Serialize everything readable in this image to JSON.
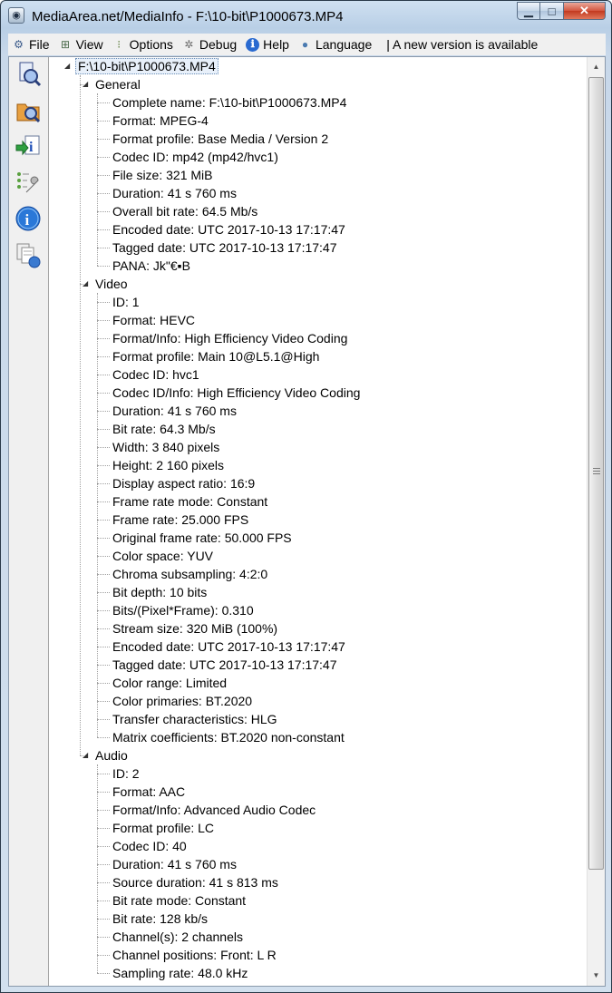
{
  "window": {
    "title": "MediaArea.net/MediaInfo - F:\\10-bit\\P1000673.MP4"
  },
  "menu": {
    "items": [
      {
        "label": "File",
        "icon": "file-icon"
      },
      {
        "label": "View",
        "icon": "view-icon"
      },
      {
        "label": "Options",
        "icon": "options-icon"
      },
      {
        "label": "Debug",
        "icon": "debug-icon"
      },
      {
        "label": "Help",
        "icon": "help-icon"
      },
      {
        "label": "Language",
        "icon": "globe-icon"
      }
    ],
    "notice": "| A new version is available"
  },
  "toolbar": {
    "icons": [
      "open-file-icon",
      "open-folder-icon",
      "export-info-icon",
      "settings-icon",
      "about-icon",
      "sheet-view-icon"
    ]
  },
  "tree": {
    "root": "F:\\10-bit\\P1000673.MP4",
    "sections": [
      {
        "name": "General",
        "fields": [
          "Complete name: F:\\10-bit\\P1000673.MP4",
          "Format: MPEG-4",
          "Format profile: Base Media / Version 2",
          "Codec ID: mp42 (mp42/hvc1)",
          "File size: 321 MiB",
          "Duration: 41 s 760 ms",
          "Overall bit rate: 64.5 Mb/s",
          "Encoded date: UTC 2017-10-13 17:17:47",
          "Tagged date: UTC 2017-10-13 17:17:47",
          "PANA: Jk\"€▪B"
        ]
      },
      {
        "name": "Video",
        "fields": [
          "ID: 1",
          "Format: HEVC",
          "Format/Info: High Efficiency Video Coding",
          "Format profile: Main 10@L5.1@High",
          "Codec ID: hvc1",
          "Codec ID/Info: High Efficiency Video Coding",
          "Duration: 41 s 760 ms",
          "Bit rate: 64.3 Mb/s",
          "Width: 3 840 pixels",
          "Height: 2 160 pixels",
          "Display aspect ratio: 16:9",
          "Frame rate mode: Constant",
          "Frame rate: 25.000 FPS",
          "Original frame rate: 50.000 FPS",
          "Color space: YUV",
          "Chroma subsampling: 4:2:0",
          "Bit depth: 10 bits",
          "Bits/(Pixel*Frame): 0.310",
          "Stream size: 320 MiB (100%)",
          "Encoded date: UTC 2017-10-13 17:17:47",
          "Tagged date: UTC 2017-10-13 17:17:47",
          "Color range: Limited",
          "Color primaries: BT.2020",
          "Transfer characteristics: HLG",
          "Matrix coefficients: BT.2020 non-constant"
        ]
      },
      {
        "name": "Audio",
        "fields": [
          "ID: 2",
          "Format: AAC",
          "Format/Info: Advanced Audio Codec",
          "Format profile: LC",
          "Codec ID: 40",
          "Duration: 41 s 760 ms",
          "Source duration: 41 s 813 ms",
          "Bit rate mode: Constant",
          "Bit rate: 128 kb/s",
          "Channel(s): 2 channels",
          "Channel positions: Front: L R",
          "Sampling rate: 48.0 kHz"
        ]
      }
    ]
  },
  "scrollbar": {
    "position": 0.0
  }
}
